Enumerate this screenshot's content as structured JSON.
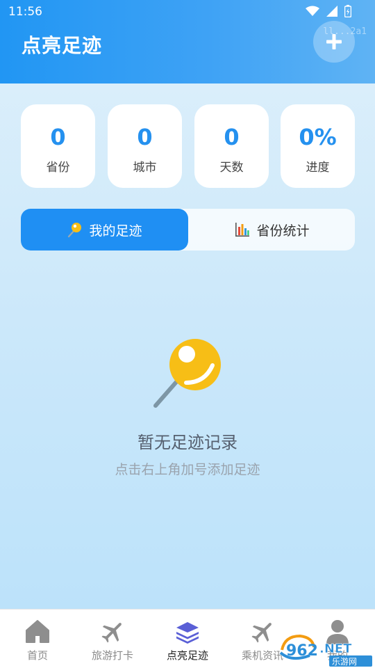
{
  "status_bar": {
    "time": "11:56"
  },
  "header": {
    "title": "点亮足迹",
    "add_icon": "plus-icon",
    "id_text": "ll...2a1"
  },
  "stats": [
    {
      "value": "0",
      "label": "省份"
    },
    {
      "value": "0",
      "label": "城市"
    },
    {
      "value": "0",
      "label": "天数"
    },
    {
      "value": "0%",
      "label": "进度"
    }
  ],
  "tabs": [
    {
      "label": "我的足迹",
      "icon": "pushpin-icon",
      "active": true
    },
    {
      "label": "省份统计",
      "icon": "bar-chart-icon",
      "active": false
    }
  ],
  "empty_state": {
    "icon": "pushpin-icon",
    "title": "暂无足迹记录",
    "subtitle": "点击右上角加号添加足迹"
  },
  "bottom_nav": [
    {
      "label": "首页",
      "icon": "home-icon"
    },
    {
      "label": "旅游打卡",
      "icon": "airplane-icon"
    },
    {
      "label": "点亮足迹",
      "icon": "layers-icon",
      "active": true
    },
    {
      "label": "乘机资讯",
      "icon": "airplane-icon"
    },
    {
      "label": "我的",
      "icon": "person-icon"
    }
  ],
  "watermark": {
    "brand": "962.NET",
    "subtitle": "乐游网"
  },
  "colors": {
    "accent": "#1f8ff3",
    "header_start": "#2196f3",
    "pin_yellow": "#f7be16"
  }
}
